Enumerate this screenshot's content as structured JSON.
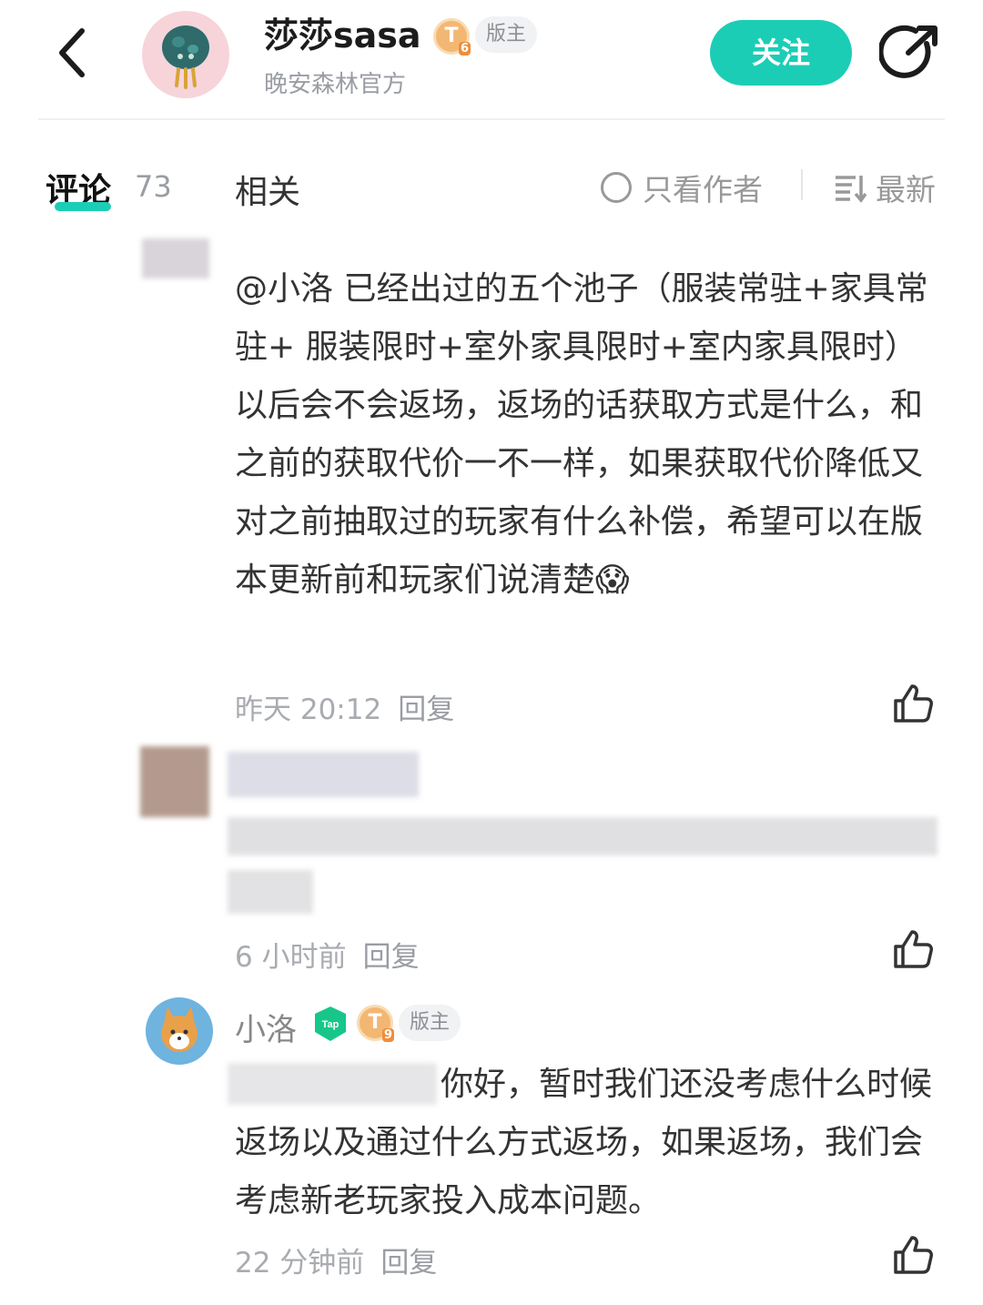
{
  "header": {
    "user_name": "莎莎sasa",
    "level_letter": "T",
    "level_num": "6",
    "mod_tag": "版主",
    "subtitle": "晚安森林官方",
    "follow_label": "关注",
    "back_icon": "chevron-left-icon",
    "share_icon": "share-icon"
  },
  "tabs": {
    "comments_label": "评论",
    "comments_count": "73",
    "related_label": "相关",
    "author_only_label": "只看作者",
    "sort_label": "最新"
  },
  "comments": [
    {
      "text": "@小洛  已经出过的五个池子（服装常驻+家具常驻+ 服装限时+室外家具限时+室内家具限时）以后会不会返场，返场的话获取方式是什么，和之前的获取代价一不一样，如果获取代价降低又对之前抽取过的玩家有什么补偿，希望可以在版本更新前和玩家们说清楚😱",
      "time": "昨天 20:12",
      "reply_label": "回复"
    },
    {
      "time": "6 小时前",
      "reply_label": "回复"
    },
    {
      "author": "小洛",
      "level_letter": "T",
      "level_num": "9",
      "mod_tag": "版主",
      "text": "你好，暂时我们还没考虑什么时候返场以及通过什么方式返场，如果返场，我们会考虑新老玩家投入成本问题。",
      "time": "22 分钟前",
      "reply_label": "回复"
    }
  ],
  "colors": {
    "accent": "#1ccdb6",
    "muted": "#9a9da3"
  }
}
